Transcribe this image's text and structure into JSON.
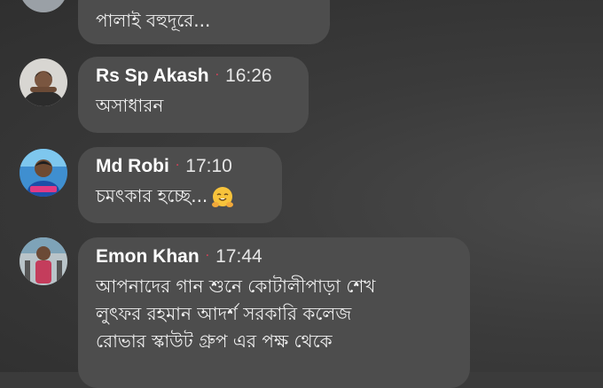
{
  "messages": [
    {
      "text": "পালাই বহুদূরে..."
    },
    {
      "name": "Rs Sp Akash",
      "time": "16:26",
      "text": "অসাধারন"
    },
    {
      "name": "Md Robi",
      "time": "17:10",
      "text": "চমৎকার হচ্ছে...",
      "emoji": "smiling-hug-emoji"
    },
    {
      "name": "Emon Khan",
      "time": "17:44",
      "text_lines": [
        "আপনাদের গান শুনে কোটালীপাড়া শেখ",
        "লুৎফর রহমান আদর্শ সরকারি কলেজ",
        "রোভার স্কাউট গ্রুপ এর পক্ষ থেকে"
      ]
    }
  ],
  "colors": {
    "bubble": "#4d4d4d",
    "background": "#3b3b3b",
    "separator_dot": "#e0405a"
  },
  "separator": "·"
}
